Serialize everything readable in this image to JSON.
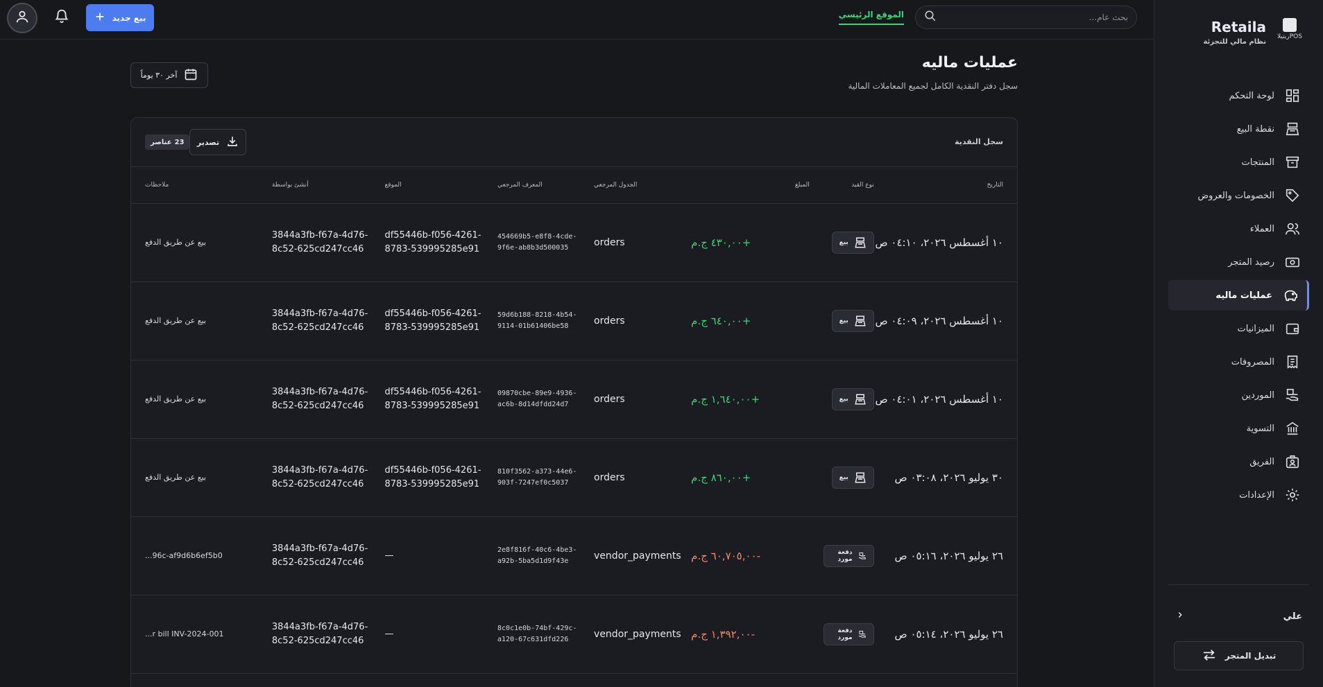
{
  "brand": {
    "name": "Retaila",
    "logo_caption": "POSريتيلا",
    "tagline": "نظام مالي للتجزئة"
  },
  "sidebar": {
    "items": [
      {
        "label": "لوحة التحكم",
        "icon": "dashboard-icon"
      },
      {
        "label": "نقطة البيع",
        "icon": "register-icon"
      },
      {
        "label": "المنتجات",
        "icon": "archive-icon"
      },
      {
        "label": "الخصومات والعروض",
        "icon": "tag-icon"
      },
      {
        "label": "العملاء",
        "icon": "users-icon"
      },
      {
        "label": "رصيد المتجر",
        "icon": "cash-icon"
      },
      {
        "label": "عمليات ماليه",
        "icon": "piggy-bank-icon",
        "active": true
      },
      {
        "label": "الميزانيات",
        "icon": "wallet-icon"
      },
      {
        "label": "المصروفات",
        "icon": "receipt-icon"
      },
      {
        "label": "الموردين",
        "icon": "supplier-icon"
      },
      {
        "label": "التسوية",
        "icon": "bank-icon"
      },
      {
        "label": "الفريق",
        "icon": "team-icon"
      },
      {
        "label": "الإعدادات",
        "icon": "gear-icon"
      }
    ],
    "user_name": "علي",
    "switch_store_label": "تبديل المتجر"
  },
  "topbar": {
    "search_placeholder": "بحث عام...",
    "home_link": "الموقع الرئيسي",
    "new_sale_label": "بيع جديد"
  },
  "page": {
    "title": "عمليات ماليه",
    "subtitle": "سجل دفتر النقدية الكامل لجميع المعاملات المالية",
    "date_filter": "آخر ٣٠ يوماً"
  },
  "ledger": {
    "title": "سجل النقدية",
    "export_label": "تصدير",
    "count": "23",
    "count_suffix": "عناصر",
    "columns": {
      "date": "التاريخ",
      "type": "نوع القيد",
      "amount": "المبلغ",
      "ref_table": "الجدول المرجعي",
      "ref_id": "المعرف المرجعي",
      "location": "الموقع",
      "created_by": "أنشئ بواسطة",
      "notes": "ملاحظات"
    },
    "rows": [
      {
        "date": "١٠ أغسطس ٢٠٢٦، ٠٤:١٠ ص",
        "type": "بيع",
        "amount": "+٤٣٠,٠٠ ج.م",
        "positive": true,
        "ref_table": "orders",
        "ref_id": "454669b5-e8f8-4cde-9f6e-ab8b3d500035",
        "location": "df55446b-f056-4261-8783-539995285e91",
        "created_by": "3844a3fb-f67a-4d76-8c52-625cd247cc46",
        "notes": "بيع عن طريق الدفع"
      },
      {
        "date": "١٠ أغسطس ٢٠٢٦، ٠٤:٠٩ ص",
        "type": "بيع",
        "amount": "+٦٤٠,٠٠ ج.م",
        "positive": true,
        "ref_table": "orders",
        "ref_id": "59d6b188-8218-4b54-9114-01b61406be58",
        "location": "df55446b-f056-4261-8783-539995285e91",
        "created_by": "3844a3fb-f67a-4d76-8c52-625cd247cc46",
        "notes": "بيع عن طريق الدفع"
      },
      {
        "date": "١٠ أغسطس ٢٠٢٦، ٠٤:٠١ ص",
        "type": "بيع",
        "amount": "+١,٦٤٠,٠٠ ج.م",
        "positive": true,
        "ref_table": "orders",
        "ref_id": "09870cbe-89e9-4936-ac6b-8d14dfdd24d7",
        "location": "df55446b-f056-4261-8783-539995285e91",
        "created_by": "3844a3fb-f67a-4d76-8c52-625cd247cc46",
        "notes": "بيع عن طريق الدفع"
      },
      {
        "date": "٣٠ يوليو ٢٠٢٦، ٠٣:٠٨ ص",
        "type": "بيع",
        "amount": "+٨٦٠,٠٠ ج.م",
        "positive": true,
        "ref_table": "orders",
        "ref_id": "810f3562-a373-44e6-903f-7247ef0c5037",
        "location": "df55446b-f056-4261-8783-539995285e91",
        "created_by": "3844a3fb-f67a-4d76-8c52-625cd247cc46",
        "notes": "بيع عن طريق الدفع"
      },
      {
        "date": "٢٦ يوليو ٢٠٢٦، ٠٥:١٦ ص",
        "type": "دفعة مورد",
        "amount": "-٦٠,٧٠٥,٠٠ ج.م",
        "positive": false,
        "ref_table": "vendor_payments",
        "ref_id": "2e8f816f-40c6-4be3-a92b-5ba5d1d9f43e",
        "location": "—",
        "created_by": "3844a3fb-f67a-4d76-8c52-625cd247cc46",
        "notes": "...96c-af9d6b6ef5b0"
      },
      {
        "date": "٢٦ يوليو ٢٠٢٦، ٠٥:١٤ ص",
        "type": "دفعة مورد",
        "amount": "-١,٣٩٢,٠٠ ج.م",
        "positive": false,
        "ref_table": "vendor_payments",
        "ref_id": "8c0c1e0b-74bf-429c-a120-67c631dfd226",
        "location": "—",
        "created_by": "3844a3fb-f67a-4d76-8c52-625cd247cc46",
        "notes": "...r bill INV-2024-001"
      }
    ]
  },
  "colors": {
    "accent": "#4d7cf0",
    "positive": "#3fd47a",
    "negative": "#f28b6a",
    "background": "#17181c"
  }
}
